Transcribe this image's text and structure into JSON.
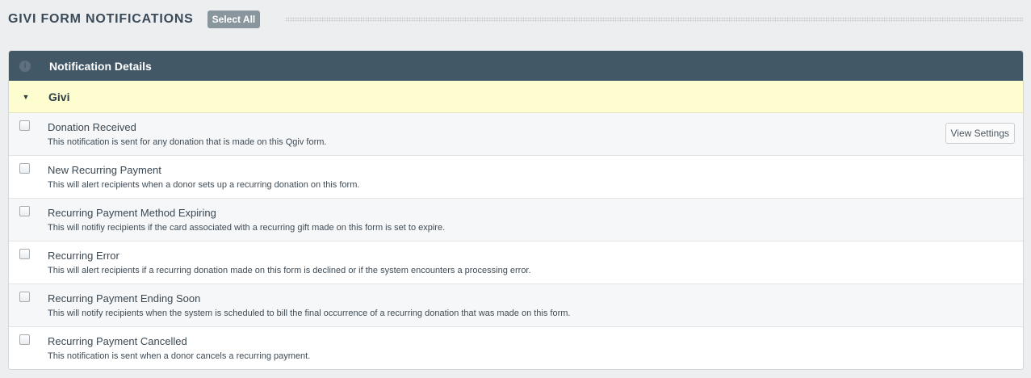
{
  "header": {
    "title": "GIVI FORM NOTIFICATIONS",
    "select_all_label": "Select All"
  },
  "panel": {
    "title": "Notification Details",
    "info_icon": "info-icon",
    "group": {
      "label": "Givi",
      "caret": "▼"
    },
    "view_settings_label": "View Settings",
    "notifications": [
      {
        "title": "Donation Received",
        "description": "This notification is sent for any donation that is made on this Qgiv form.",
        "checked": false
      },
      {
        "title": "New Recurring Payment",
        "description": "This will alert recipients when a donor sets up a recurring donation on this form.",
        "checked": false
      },
      {
        "title": "Recurring Payment Method Expiring",
        "description": "This will notifiy recipients if the card associated with a recurring gift made on this form is set to expire.",
        "checked": false
      },
      {
        "title": "Recurring Error",
        "description": "This will alert recipients if a recurring donation made on this form is declined or if the system encounters a processing error.",
        "checked": false
      },
      {
        "title": "Recurring Payment Ending Soon",
        "description": "This will notify recipients when the system is scheduled to bill the final occurrence of a recurring donation that was made on this form.",
        "checked": false
      },
      {
        "title": "Recurring Payment Cancelled",
        "description": "This notification is sent when a donor cancels a recurring payment.",
        "checked": false
      }
    ]
  },
  "colors": {
    "panel_header": "#435867",
    "group_highlight": "#fdfdd0",
    "select_all_bg": "#8a969e",
    "page_bg": "#eceeef"
  }
}
